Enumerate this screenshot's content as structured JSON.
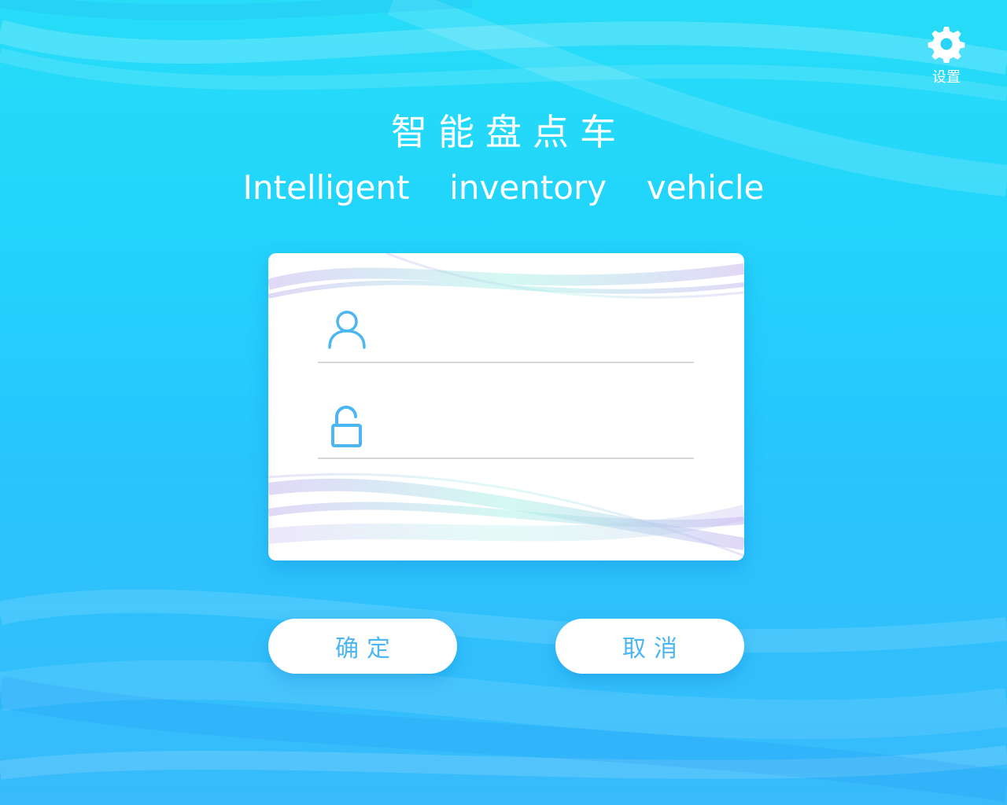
{
  "header": {
    "title_cn": "智能盘点车",
    "title_en": "Intelligent  inventory  vehicle"
  },
  "settings": {
    "label": "设置",
    "icon": "gear-icon"
  },
  "login_form": {
    "username": {
      "icon": "user-icon",
      "value": "",
      "placeholder": ""
    },
    "password": {
      "icon": "unlock-icon",
      "value": "",
      "placeholder": ""
    }
  },
  "buttons": {
    "confirm_label": "确定",
    "cancel_label": "取消"
  },
  "colors": {
    "accent": "#4cb6f2",
    "background_top": "#27dcf8",
    "background_bottom": "#38bafb",
    "card": "#ffffff",
    "divider": "#d6d6d6"
  }
}
